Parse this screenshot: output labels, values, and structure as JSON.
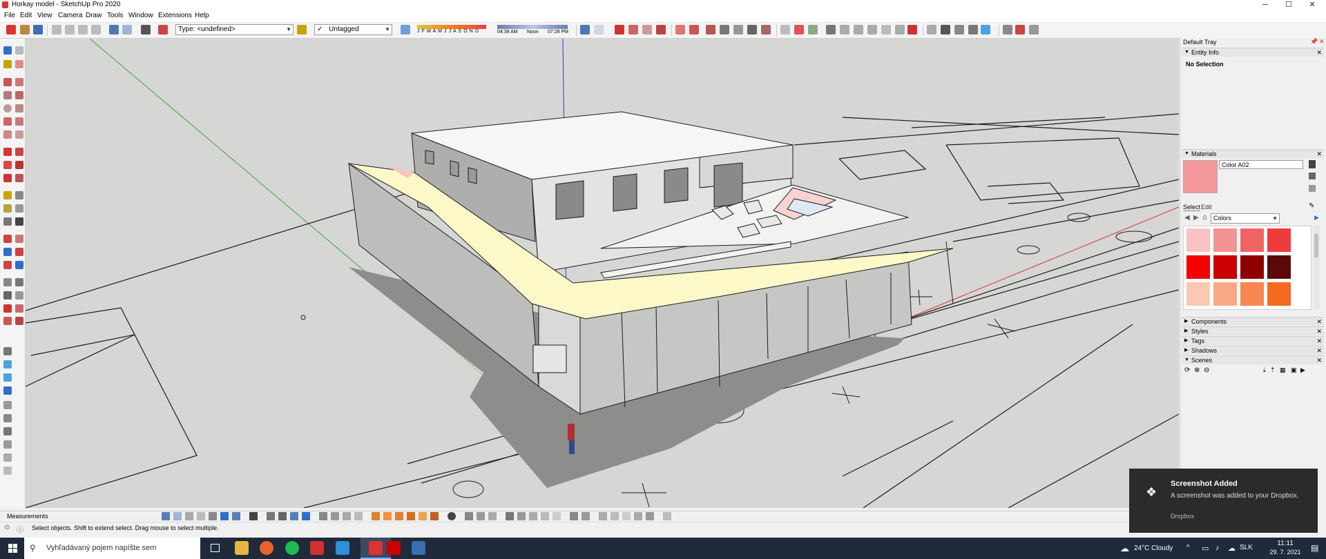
{
  "window": {
    "title": "Horkay model - SketchUp Pro 2020",
    "minimize": "─",
    "maximize": "☐",
    "close": "✕"
  },
  "menus": [
    "File",
    "Edit",
    "View",
    "Camera",
    "Draw",
    "Tools",
    "Window",
    "Extensions",
    "Help"
  ],
  "toolbar": {
    "type_combo": "Type: <undefined>",
    "tag_combo": "Untagged",
    "tag_check": "✓",
    "months": "J F M A M J J A S O N D",
    "time_start": "04:39 AM",
    "time_noon": "Noon",
    "time_end": "07:28 PM"
  },
  "tray": {
    "title": "Default Tray",
    "entity_info": {
      "title": "Entity Info",
      "selection": "No Selection"
    },
    "materials": {
      "title": "Materials",
      "color_name": "Color A02",
      "tab_select": "Select",
      "tab_edit": "Edit",
      "library": "Colors",
      "current_color": "#f4979a",
      "swatches": [
        "#f9c3c3",
        "#f39393",
        "#f06363",
        "#ef3b3b",
        "#f40000",
        "#cb0000",
        "#8f0000",
        "#5c0808",
        "#fac8b4",
        "#f8a884",
        "#f78650",
        "#f56a20",
        "#f85000",
        "#c63e0a",
        "#8c2b0a",
        "#5a1e0c"
      ]
    },
    "panels": [
      "Components",
      "Styles",
      "Tags",
      "Shadows",
      "Scenes"
    ]
  },
  "measurements": {
    "label": "Measurements"
  },
  "status": {
    "hint": "Select objects. Shift to extend select. Drag mouse to select multiple."
  },
  "notification": {
    "title": "Screenshot Added",
    "body": "A screenshot was added to your Dropbox.",
    "source": "Dropbox"
  },
  "taskbar": {
    "search_placeholder": "Vyhľadávaný pojem napíšte sem",
    "weather": "24°C  Cloudy",
    "language": "SLK",
    "time": "11:11",
    "date": "29. 7. 2021"
  },
  "icons": {
    "start": "windows-start-icon",
    "search": "search-icon",
    "task_view": "task-view-icon",
    "explorer": "folder-icon",
    "firefox": "firefox-icon",
    "spotify": "spotify-icon",
    "acrobat": "acrobat-icon",
    "photos": "photos-icon",
    "sketchup": "sketchup-icon",
    "pdf": "pdf-icon",
    "calculator": "calculator-icon"
  },
  "colors": {
    "accent": "#2f6fc8",
    "taskbar": "#1f2a3a",
    "viewport": "#d6d6d4",
    "shadow": "#8d8d8b",
    "highlight": "#fdf8c8"
  }
}
